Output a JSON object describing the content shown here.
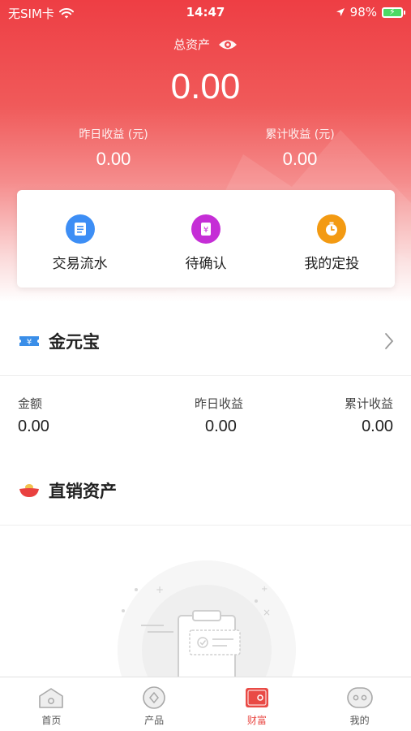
{
  "status_bar": {
    "carrier": "无SIM卡",
    "time": "14:47",
    "battery": "98%",
    "battery_level": 0.98,
    "icons": [
      "wifi-icon",
      "location-arrow-icon",
      "battery-charging-icon"
    ]
  },
  "hero": {
    "total_label": "总资产",
    "total_value": "0.00",
    "yesterday_label": "昨日收益 (元)",
    "yesterday_value": "0.00",
    "cumulative_label": "累计收益 (元)",
    "cumulative_value": "0.00",
    "colors": {
      "top": "#ee3e44",
      "bottom": "#ffffff"
    }
  },
  "quick_actions": [
    {
      "label": "交易流水",
      "icon": "transaction-list-icon",
      "color": "#3d8ef5"
    },
    {
      "label": "待确认",
      "icon": "pending-confirm-icon",
      "color": "#c52ed6"
    },
    {
      "label": "我的定投",
      "icon": "timer-icon",
      "color": "#f39a12"
    }
  ],
  "jin_yuan_bao": {
    "title": "金元宝",
    "icon": "ticket-yuan-icon",
    "labels": [
      "金额",
      "昨日收益",
      "累计收益"
    ],
    "values": [
      "0.00",
      "0.00",
      "0.00"
    ]
  },
  "direct_assets": {
    "title": "直销资产",
    "icon": "gold-ingot-icon"
  },
  "tabbar": {
    "tabs": [
      {
        "label": "首页",
        "icon": "home-icon",
        "active": false
      },
      {
        "label": "产品",
        "icon": "product-icon",
        "active": false
      },
      {
        "label": "财富",
        "icon": "wallet-icon",
        "active": true
      },
      {
        "label": "我的",
        "icon": "profile-icon",
        "active": false
      }
    ],
    "active_color": "#e94a45"
  }
}
